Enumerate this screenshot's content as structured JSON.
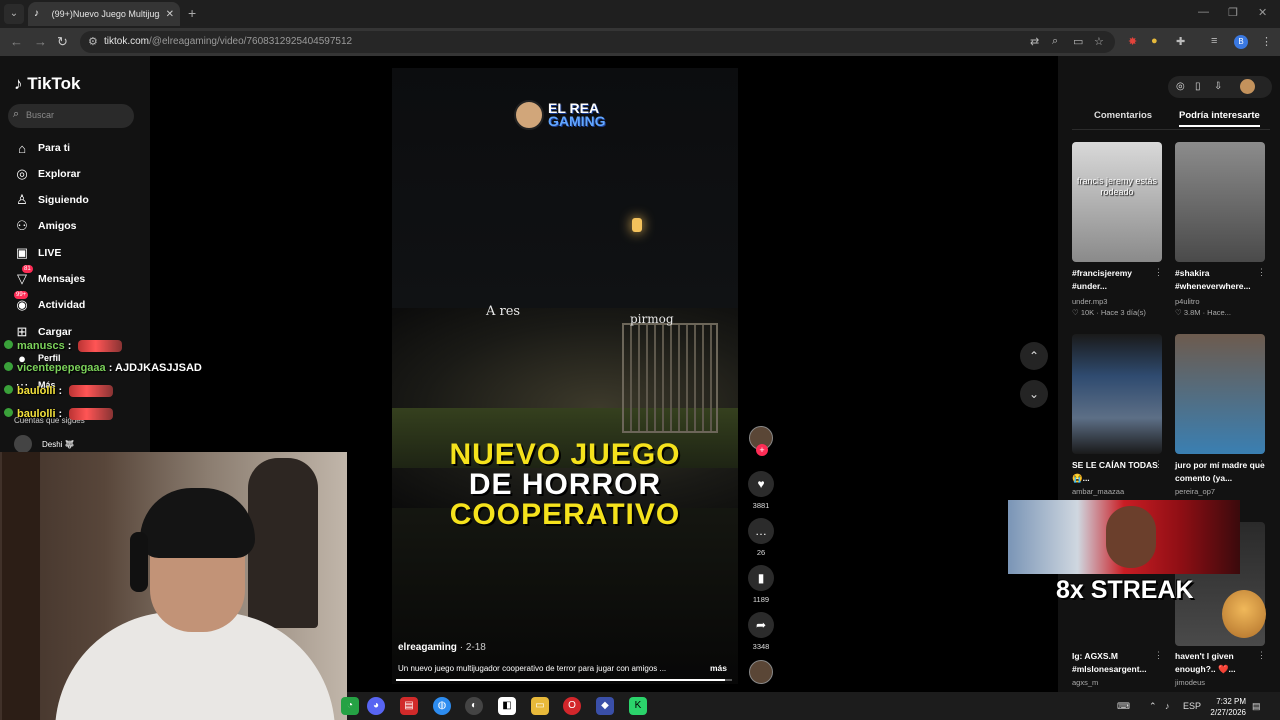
{
  "browser": {
    "tab_title": "(99+)Nuevo Juego Multijugado",
    "url_host": "tiktok.com",
    "url_path": "/@elreagaming/video/7608312925404597512"
  },
  "tiktok": {
    "logo": "TikTok",
    "search_placeholder": "Buscar",
    "nav": [
      {
        "label": "Para ti",
        "icon": "home-icon"
      },
      {
        "label": "Explorar",
        "icon": "compass-icon"
      },
      {
        "label": "Siguiendo",
        "icon": "following-icon"
      },
      {
        "label": "Amigos",
        "icon": "friends-icon"
      },
      {
        "label": "LIVE",
        "icon": "live-icon"
      },
      {
        "label": "Mensajes",
        "icon": "messages-icon",
        "badge": "81"
      },
      {
        "label": "Actividad",
        "icon": "activity-icon",
        "badge": "99+"
      },
      {
        "label": "Cargar",
        "icon": "upload-icon"
      },
      {
        "label": "Perfil",
        "icon": "profile-icon"
      },
      {
        "label": "Más",
        "icon": "more-icon"
      }
    ],
    "following_label": "Cuentas que sigues",
    "following_user": "Deshi 🐺"
  },
  "chat": [
    {
      "user": "manuscs",
      "message": ""
    },
    {
      "user": "vicentepepegaaa",
      "message": "AJDJKASJJSAD"
    },
    {
      "user": "baulolli",
      "message": ""
    },
    {
      "user": "baulolli",
      "message": ""
    }
  ],
  "video": {
    "logo_line1": "EL REA",
    "logo_line2": "GAMING",
    "scene_label_left": "A res",
    "scene_label_right": "pirmog",
    "headline_line1": "NUEVO JUEGO",
    "headline_line2": "DE HORROR",
    "headline_line3": "COOPERATIVO",
    "author": "elreagaming",
    "date": "2-18",
    "description": "Un nuevo juego multijugador cooperativo de terror para jugar con amigos ...",
    "more": "más",
    "progress": 0.98
  },
  "actions": {
    "likes": "3881",
    "comments": "26",
    "saves": "1189",
    "shares": "3348"
  },
  "right_panel": {
    "tab_comments": "Comentarios",
    "tab_interest": "Podría interesarte",
    "cards": [
      {
        "title": "#francisjeremy #under...",
        "meta": "under.mp3",
        "meta2": "10K · Hace 3 día(s)",
        "thumb_text": "francis jeremy estás rodeado"
      },
      {
        "title": "#shakira #wheneverwhere...",
        "meta": "p4ulitro",
        "meta2": "3.8M · Hace..."
      },
      {
        "title": "SE LE CAÍAN TODAS😭...",
        "meta": "ambar_maazaa"
      },
      {
        "title": "juro por mí madre que comento (ya...",
        "meta": "pereira_op7"
      },
      {
        "title": "Ig: AGXS.M #mlslonesargent...",
        "meta": "agxs_m"
      },
      {
        "title": "haven't I given enough?.. ❤️...",
        "meta": "jimodeus"
      }
    ]
  },
  "streak": {
    "text": "8x STREAK"
  },
  "taskbar": {
    "lang": "ESP",
    "time": "7:32 PM",
    "date": "2/27/2026"
  },
  "colors": {
    "accent": "#fe2c55",
    "headline_yellow": "#f5e21c"
  }
}
